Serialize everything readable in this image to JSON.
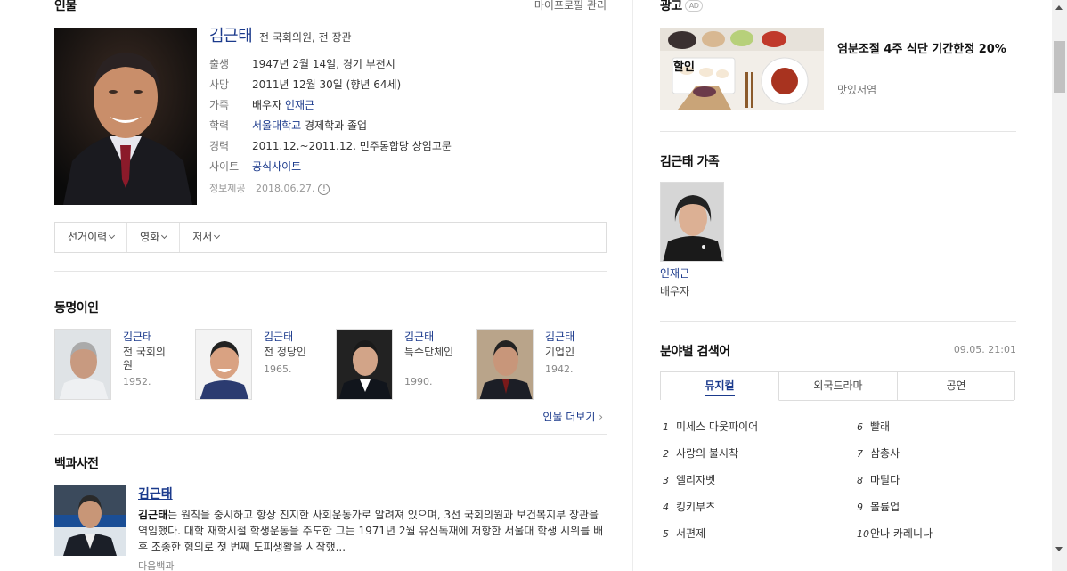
{
  "person": {
    "section_title": "인물",
    "profile_link": "마이프로필 관리",
    "name": "김근태",
    "desc": "전 국회의원, 전 장관",
    "rows": [
      {
        "label": "출생",
        "value": "1947년 2월 14일, 경기 부천시"
      },
      {
        "label": "사망",
        "value": "2011년 12월 30일 (향년 64세)"
      },
      {
        "label": "가족",
        "value_pre": "배우자 ",
        "value_link": "인재근"
      },
      {
        "label": "학력",
        "value_link": "서울대학교",
        "value_post": " 경제학과 졸업"
      },
      {
        "label": "경력",
        "value": "2011.12.~2011.12. 민주통합당 상임고문"
      },
      {
        "label": "사이트",
        "value_link": "공식사이트"
      },
      {
        "label": "정보제공",
        "value": "2018.06.27."
      }
    ],
    "tabs": [
      "선거이력",
      "영화",
      "저서"
    ]
  },
  "same_name": {
    "title": "동명이인",
    "people": [
      {
        "name": "김근태",
        "desc": "전 국회의원",
        "year": "1952."
      },
      {
        "name": "김근태",
        "desc": "전 정당인",
        "year": "1965."
      },
      {
        "name": "김근태",
        "desc": "특수단체인",
        "year": "1990."
      },
      {
        "name": "김근태",
        "desc": "기업인",
        "year": "1942."
      }
    ],
    "more": "인물 더보기"
  },
  "encyclopedia": {
    "title": "백과사전",
    "entry_name": "김근태",
    "text_bold": "김근태",
    "text_rest": "는 원칙을 중시하고 항상 진지한 사회운동가로 알려져 있으며, 3선 국회의원과 보건복지부 장관을 역임했다. 대학 재학시절 학생운동을 주도한 그는 1971년 2월 유신독재에 저항한 서울대 학생 시위를 배후 조종한 혐의로 첫 번째 도피생활을 시작했...",
    "source": "다음백과"
  },
  "ad": {
    "title": "광고",
    "badge": "AD",
    "headline_1": "염분조절 4주 식단 기간한정 20%",
    "headline_2": "할인",
    "advertiser": "맛있저염"
  },
  "family": {
    "title": "김근태 가족",
    "name": "인재근",
    "relation": "배우자"
  },
  "keywords": {
    "title": "분야별 검색어",
    "time": "09.05. 21:01",
    "tabs": [
      "뮤지컬",
      "외국드라마",
      "공연"
    ],
    "active_tab": 0,
    "items": [
      {
        "rank": "1",
        "text": "미세스 다웃파이어"
      },
      {
        "rank": "2",
        "text": "사랑의 불시착"
      },
      {
        "rank": "3",
        "text": "엘리자벳"
      },
      {
        "rank": "4",
        "text": "킹키부츠"
      },
      {
        "rank": "5",
        "text": "서편제"
      },
      {
        "rank": "6",
        "text": "빨래"
      },
      {
        "rank": "7",
        "text": "삼총사"
      },
      {
        "rank": "8",
        "text": "마틸다"
      },
      {
        "rank": "9",
        "text": "볼륨업"
      },
      {
        "rank": "10",
        "text": "안나 카레니나"
      }
    ]
  },
  "icons": {
    "info_warning": "info-warning-icon",
    "chevron": "chevron-down-icon",
    "arrow": "chevron-right-icon"
  },
  "colors": {
    "link": "#1b3a8c",
    "muted": "#888888"
  }
}
